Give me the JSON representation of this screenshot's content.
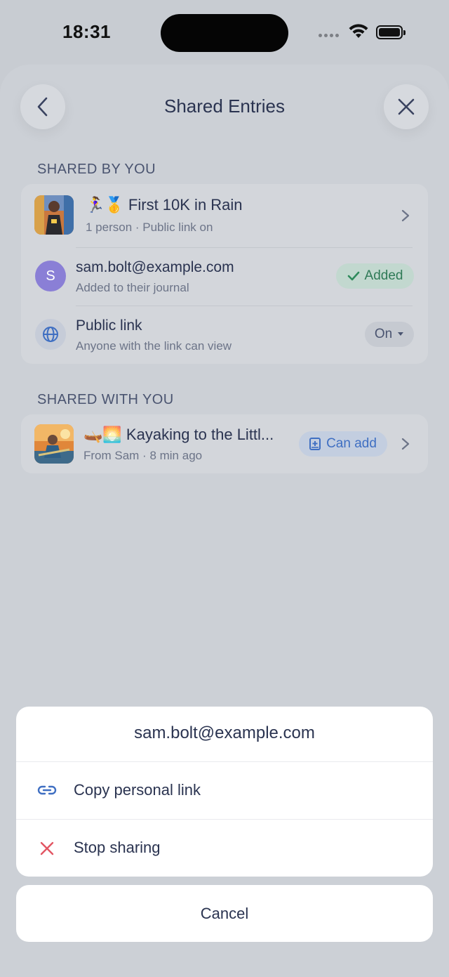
{
  "status_bar": {
    "time": "18:31"
  },
  "header": {
    "title": "Shared Entries"
  },
  "shared_by_you": {
    "label": "SHARED BY YOU",
    "entry": {
      "emoji": "🏃‍♀️🥇",
      "title": "First 10K in Rain",
      "subtitle": "1 person · Public link on"
    },
    "person": {
      "initial": "S",
      "email": "sam.bolt@example.com",
      "subtitle": "Added to their journal",
      "badge": "Added"
    },
    "public_link": {
      "title": "Public link",
      "subtitle": "Anyone with the link can view",
      "value": "On"
    }
  },
  "shared_with_you": {
    "label": "SHARED WITH YOU",
    "entry": {
      "emoji": "🛶🌅",
      "title": "Kayaking to the Littl...",
      "subtitle": "From Sam · 8 min ago",
      "badge": "Can add"
    }
  },
  "action_sheet": {
    "title": "sam.bolt@example.com",
    "items": [
      {
        "label": "Copy personal link",
        "icon": "link-icon"
      },
      {
        "label": "Stop sharing",
        "icon": "x-icon"
      }
    ],
    "cancel": "Cancel"
  },
  "colors": {
    "accent": "#3f6fc2",
    "success": "#2f8a5c",
    "danger": "#e25562",
    "avatar": "#8a7fd6"
  }
}
